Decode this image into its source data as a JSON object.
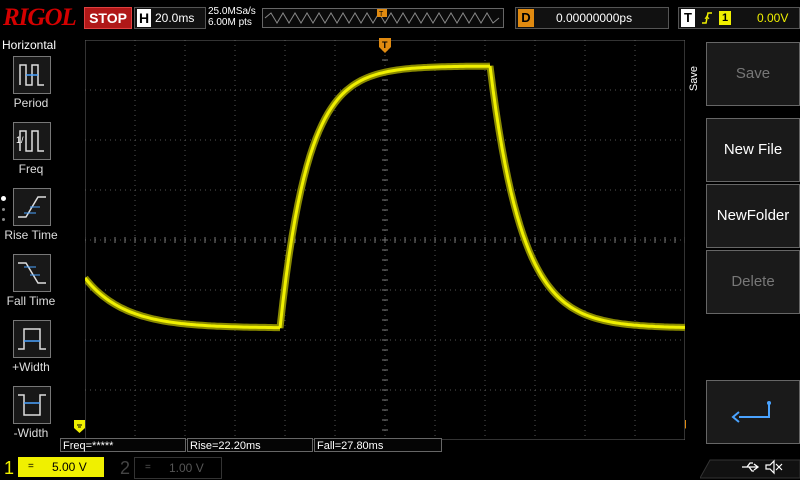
{
  "top": {
    "logo": "RIGOL",
    "run_state": "STOP",
    "horizontal_letter": "H",
    "timebase": "20.0ms",
    "sample_rate": "25.0MSa/s",
    "memory_depth": "6.00M pts",
    "delay_letter": "D",
    "delay_value": "0.00000000ps",
    "trigger_letter": "T",
    "trigger_source": "1",
    "trigger_level": "0.00V"
  },
  "left_menu": {
    "title": "Horizontal",
    "items": [
      {
        "label": "Period",
        "icon": "period-icon"
      },
      {
        "label": "Freq",
        "icon": "frequency-icon"
      },
      {
        "label": "Rise Time",
        "icon": "rise-time-icon"
      },
      {
        "label": "Fall Time",
        "icon": "fall-time-icon"
      },
      {
        "label": "+Width",
        "icon": "positive-width-icon"
      },
      {
        "label": "-Width",
        "icon": "negative-width-icon"
      }
    ]
  },
  "right_menu": {
    "side_label": "Save",
    "buttons": [
      {
        "label": "Save",
        "enabled": false
      },
      {
        "label": "New File",
        "enabled": true
      },
      {
        "label": "NewFolder",
        "enabled": true
      },
      {
        "label": "Delete",
        "enabled": false
      }
    ],
    "return_icon": "return-arrow-icon"
  },
  "measurements": {
    "freq": "Freq=*****",
    "rise": "Rise=22.20ms",
    "fall": "Fall=27.80ms"
  },
  "channels": {
    "ch1_number": "1",
    "ch1_scale": "5.00 V",
    "ch2_number": "2",
    "ch2_scale": "1.00 V"
  },
  "colors": {
    "ch1": "#f0f000",
    "trigger": "#e08a10",
    "stop": "#b01818",
    "logo": "#d40000"
  }
}
